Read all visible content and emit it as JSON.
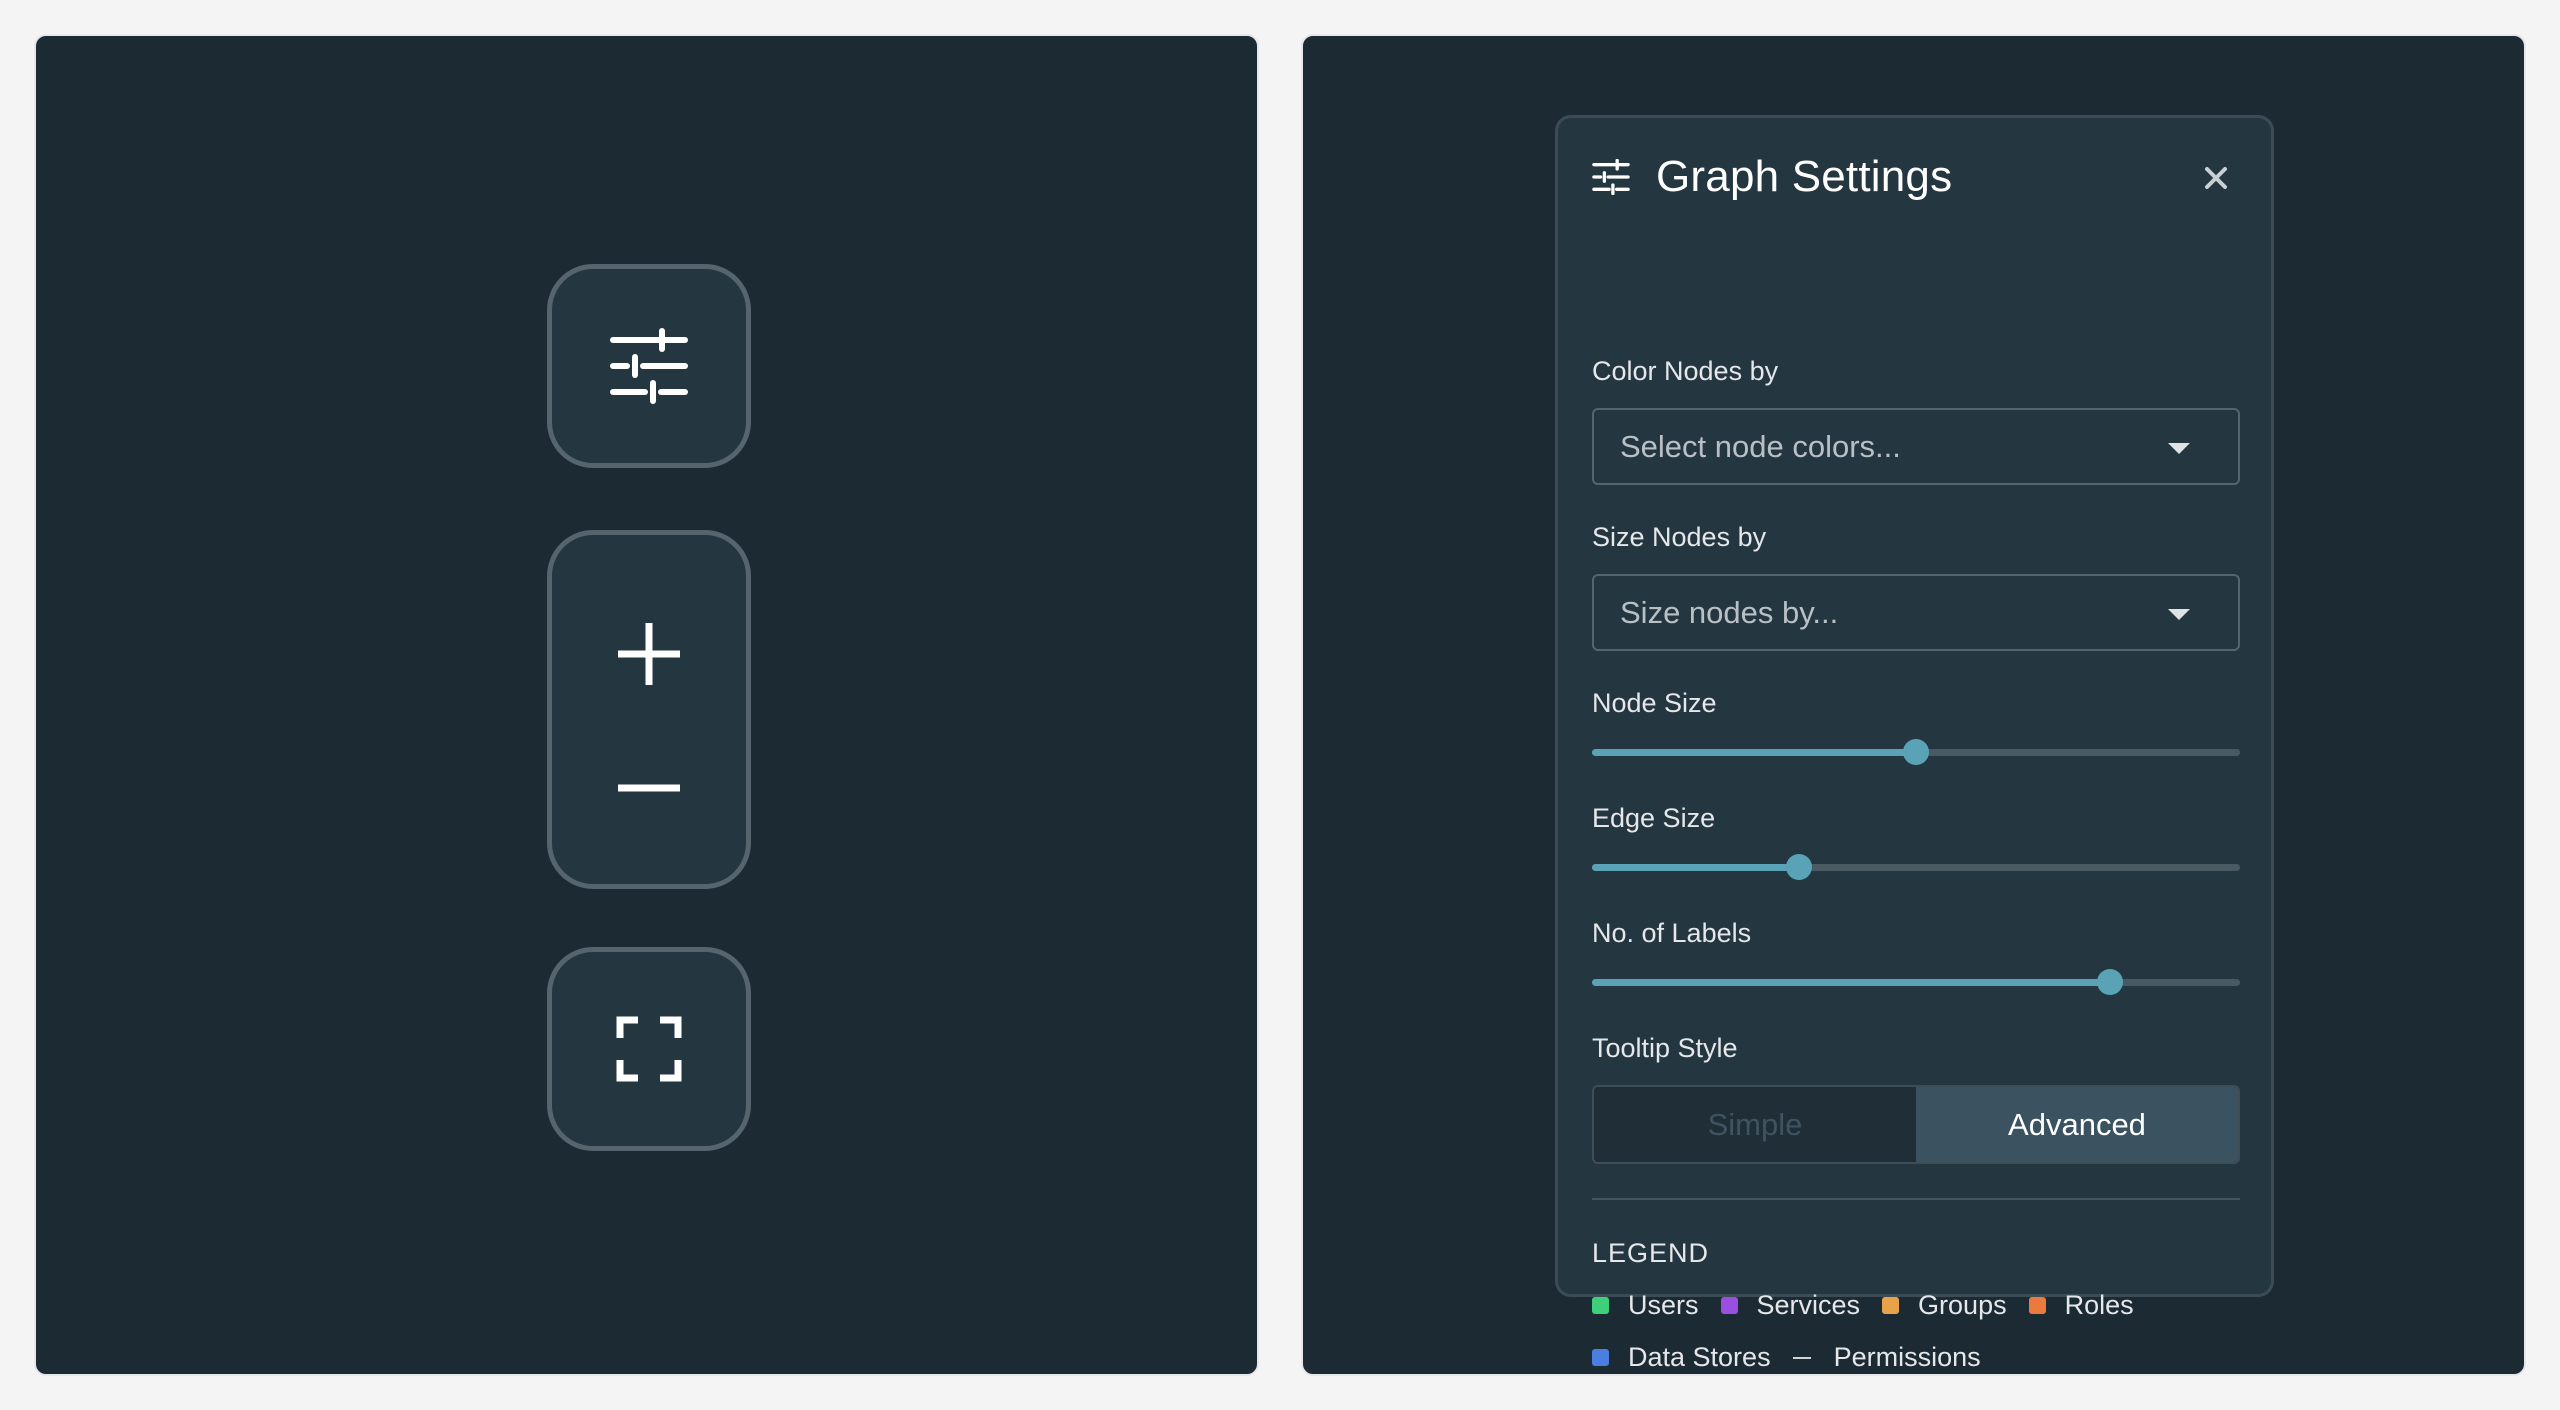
{
  "controls": {
    "settings_icon": "sliders-icon",
    "zoom_in_icon": "plus-icon",
    "zoom_out_icon": "minus-icon",
    "fit_icon": "fullscreen-icon"
  },
  "panel": {
    "title": "Graph Settings",
    "color_label": "Color Nodes by",
    "color_placeholder": "Select node colors...",
    "size_label": "Size Nodes by",
    "size_placeholder": "Size nodes by...",
    "node_size_label": "Node Size",
    "node_size_value": 0.5,
    "edge_size_label": "Edge Size",
    "edge_size_value": 0.32,
    "labels_label": "No. of Labels",
    "labels_value": 0.8,
    "tooltip_label": "Tooltip Style",
    "tooltip_options": [
      "Simple",
      "Advanced"
    ],
    "tooltip_selected": "Advanced",
    "legend_title": "LEGEND",
    "legend": [
      {
        "label": "Users",
        "color": "#3ecf7a"
      },
      {
        "label": "Services",
        "color": "#9b4fe0"
      },
      {
        "label": "Groups",
        "color": "#e9a24a"
      },
      {
        "label": "Roles",
        "color": "#ea7b3e"
      },
      {
        "label": "Data Stores",
        "color": "#4a7ee0"
      },
      {
        "label": "Permissions",
        "color": "#cfd5d9",
        "kind": "line"
      }
    ]
  },
  "colors": {
    "canvas_bg": "#1b2a33",
    "panel_bg": "#243640",
    "accent": "#5aa3b7"
  }
}
